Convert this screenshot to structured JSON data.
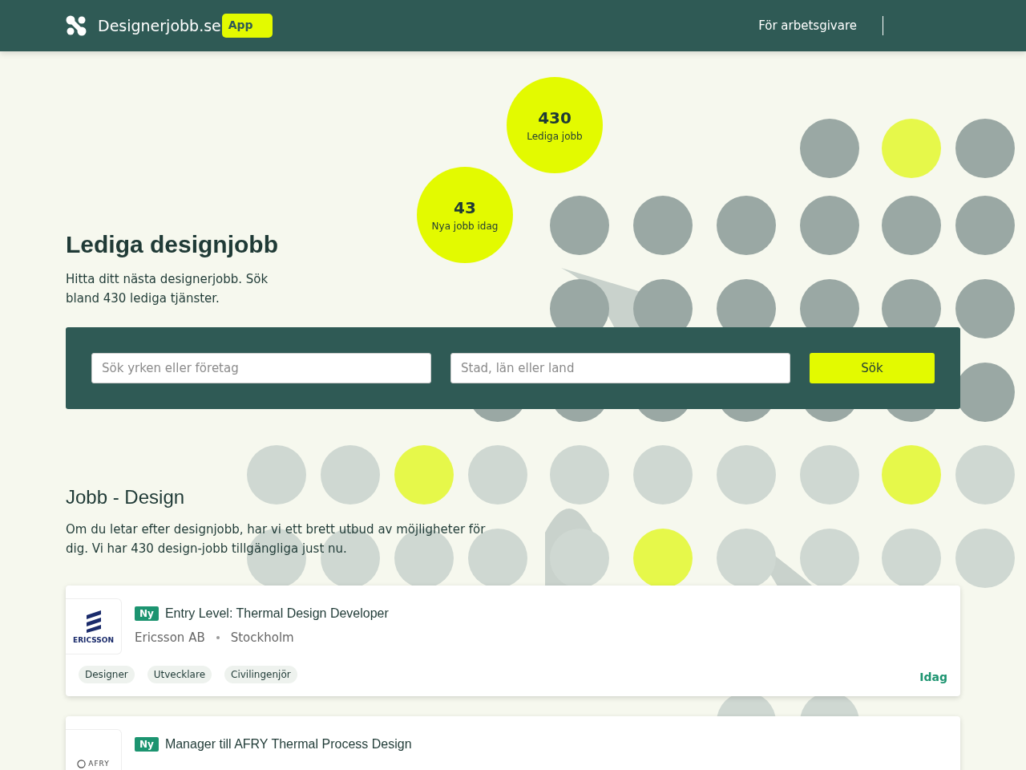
{
  "header": {
    "brand": "Designerjobb.se",
    "badge": "App",
    "nav_link": "För arbetsgivare"
  },
  "hero": {
    "title": "Lediga designjobb",
    "text": "Hitta ditt nästa designerjobb. Sök bland 430 lediga tjänster.",
    "stats": [
      {
        "value": "430",
        "label": "Lediga jobb"
      },
      {
        "value": "43",
        "label": "Nya jobb idag"
      }
    ]
  },
  "search": {
    "query_placeholder": "Sök yrken eller företag",
    "location_placeholder": "Stad, län eller land",
    "button": "Sök"
  },
  "section": {
    "title": "Jobb - Design",
    "text": "Om du letar efter designjobb, har vi ett brett utbud av möjligheter för dig. Vi har 430 design-jobb tillgängliga just nu."
  },
  "jobs": [
    {
      "logo_text": "ERICSSON",
      "kind": "bars",
      "new_badge": "Ny",
      "title": "Entry Level: Thermal Design Developer",
      "company": "Ericsson AB",
      "location": "Stockholm",
      "tags": [
        "Designer",
        "Utvecklare",
        "Civilingenjör"
      ],
      "date": "Idag"
    },
    {
      "logo_text": "AFRY",
      "kind": "ring",
      "new_badge": "Ny",
      "title": "Manager till AFRY Thermal Process Design"
    }
  ]
}
